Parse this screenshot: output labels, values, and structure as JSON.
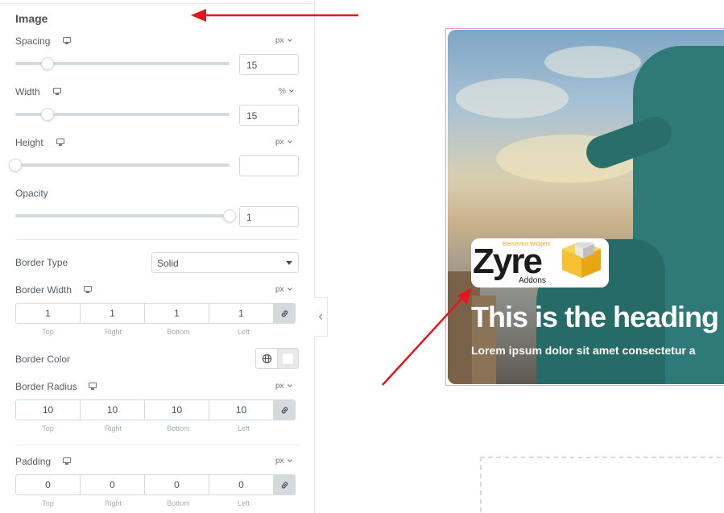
{
  "panel": {
    "section_title": "Image",
    "spacing": {
      "label": "Spacing",
      "unit": "px",
      "value": "15",
      "slider_fraction": 0.15
    },
    "width": {
      "label": "Width",
      "unit": "%",
      "value": "15",
      "slider_fraction": 0.15
    },
    "height": {
      "label": "Height",
      "unit": "px",
      "value": "",
      "slider_fraction": 0
    },
    "opacity": {
      "label": "Opacity",
      "value": "1",
      "slider_fraction": 1
    },
    "border_type": {
      "label": "Border Type",
      "selected": "Solid"
    },
    "border_width": {
      "label": "Border Width",
      "unit": "px",
      "values": [
        "1",
        "1",
        "1",
        "1"
      ]
    },
    "border_color": {
      "label": "Border Color",
      "swatch": "#ffffff"
    },
    "border_radius": {
      "label": "Border Radius",
      "unit": "px",
      "values": [
        "10",
        "10",
        "10",
        "10"
      ]
    },
    "padding": {
      "label": "Padding",
      "unit": "px",
      "values": [
        "0",
        "0",
        "0",
        "0"
      ]
    },
    "sides": [
      "Top",
      "Right",
      "Bottom",
      "Left"
    ]
  },
  "preview": {
    "logo_brand": "Zyre",
    "logo_tagline": "Elementor Widgets",
    "logo_sub": "Addons",
    "heading": "This is the heading",
    "body": "Lorem ipsum dolor sit amet consectetur a"
  },
  "colors": {
    "annotation_arrow": "#e5161b",
    "card_outline": "#d9a5e6"
  }
}
